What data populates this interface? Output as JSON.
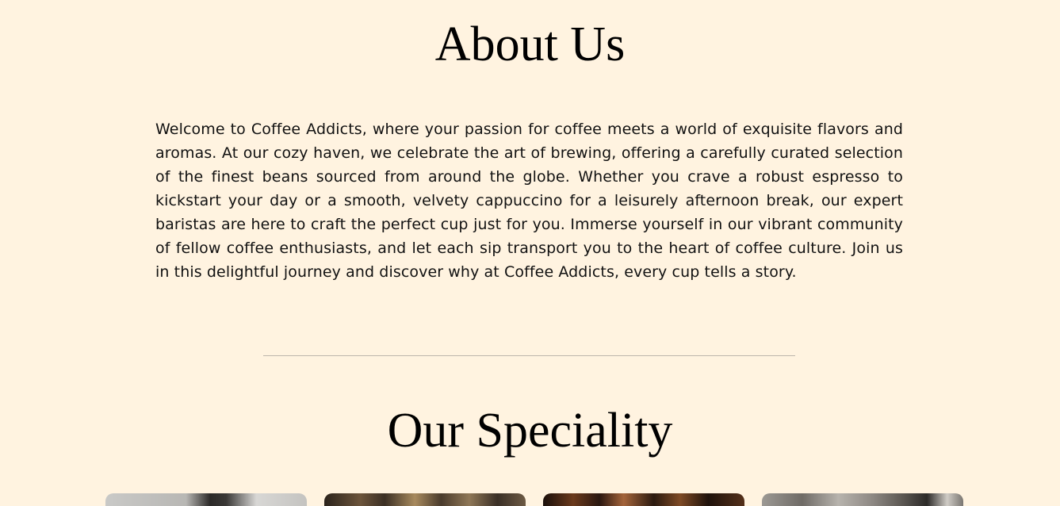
{
  "about": {
    "title": "About Us",
    "paragraph": "Welcome to Coffee Addicts, where your passion for coffee meets a world of exquisite flavors and aromas. At our cozy haven, we celebrate the art of brewing, offering a carefully curated selection of the finest beans sourced from around the globe. Whether you crave a robust espresso to kickstart your day or a smooth, velvety cappuccino for a leisurely afternoon break, our expert baristas are here to craft the perfect cup just for you. Immerse yourself in our vibrant community of fellow coffee enthusiasts, and let each sip transport you to the heart of coffee culture. Join us in this delightful journey and discover why at Coffee Addicts, every cup tells a story."
  },
  "speciality": {
    "title": "Our Speciality",
    "cards": [
      {
        "image": "coffee-photo-1"
      },
      {
        "image": "coffee-photo-2"
      },
      {
        "image": "coffee-photo-3"
      },
      {
        "image": "coffee-photo-4"
      }
    ]
  },
  "colors": {
    "background": "#FFF3E0",
    "text": "#111111",
    "divider": "#BDB6AC"
  }
}
